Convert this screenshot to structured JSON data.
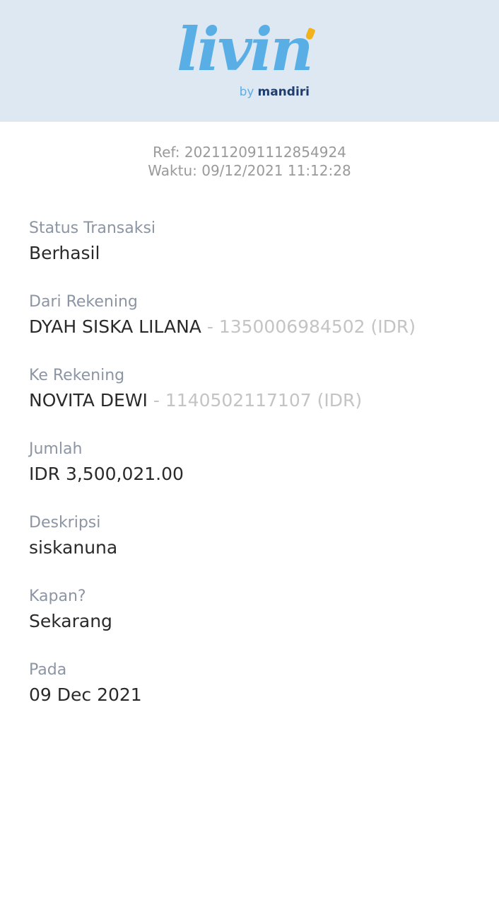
{
  "brand": {
    "logo_text": "livin",
    "sub_prefix": "by",
    "sub_brand": "mandiri"
  },
  "meta": {
    "ref_label": "Ref:",
    "ref_value": "202112091112854924",
    "time_label": "Waktu:",
    "time_value": "09/12/2021 11:12:28"
  },
  "fields": {
    "status": {
      "label": "Status Transaksi",
      "value": "Berhasil"
    },
    "from": {
      "label": "Dari Rekening",
      "name": "DYAH SISKA LILANA",
      "separator": " - ",
      "account": "1350006984502 (IDR)"
    },
    "to": {
      "label": "Ke Rekening",
      "name": "NOVITA DEWI",
      "separator": " - ",
      "account": "1140502117107 (IDR)"
    },
    "amount": {
      "label": "Jumlah",
      "value": "IDR 3,500,021.00"
    },
    "description": {
      "label": "Deskripsi",
      "value": "siskanuna"
    },
    "when": {
      "label": "Kapan?",
      "value": "Sekarang"
    },
    "date": {
      "label": "Pada",
      "value": "09 Dec 2021"
    }
  },
  "colors": {
    "header_bg": "#dde8f3",
    "logo_blue": "#5aaee6",
    "logo_accent": "#f2b21b",
    "brand_navy": "#1f3d6f"
  }
}
